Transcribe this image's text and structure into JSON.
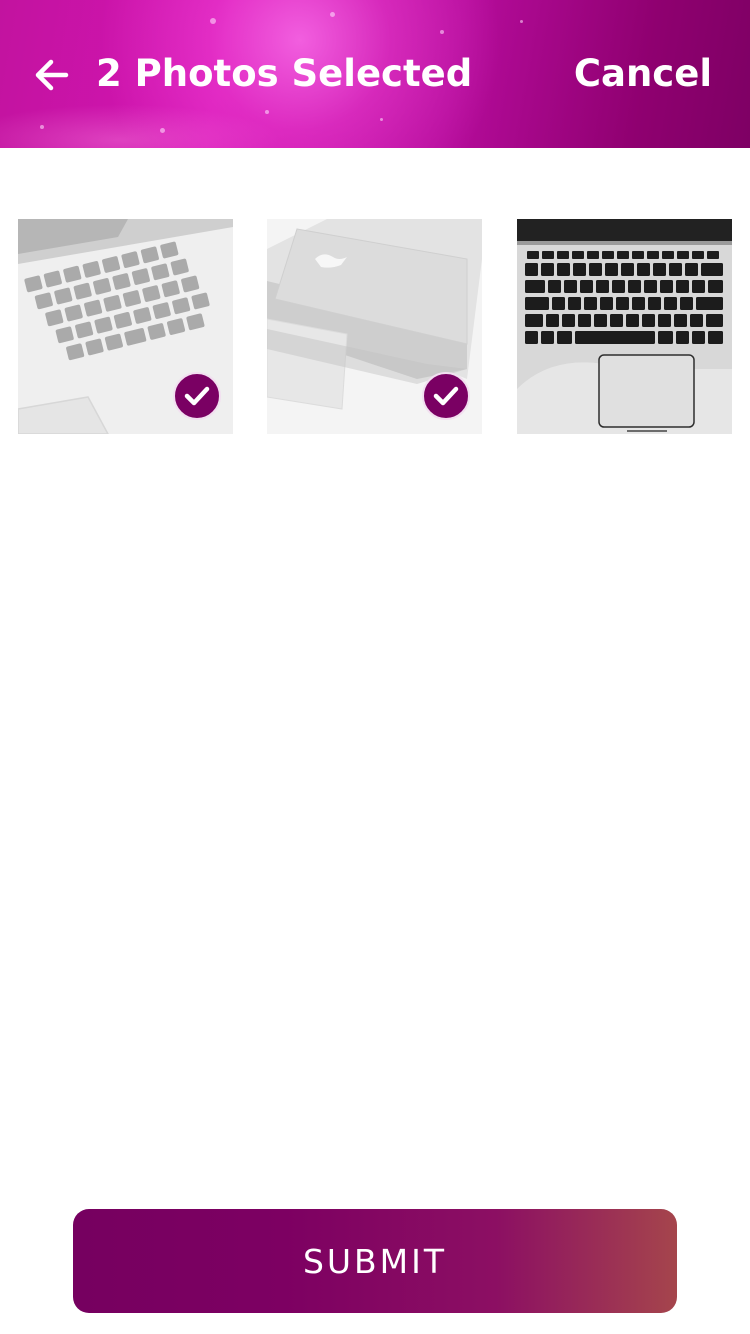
{
  "header": {
    "back_icon": "arrow-left-icon",
    "title": "2 Photos Selected",
    "cancel_label": "Cancel"
  },
  "photos": [
    {
      "subject": "laptop keyboard close-up",
      "selected": true
    },
    {
      "subject": "closed laptop lid",
      "selected": true
    },
    {
      "subject": "laptop keyboard and trackpad",
      "selected": false
    }
  ],
  "selection_icon": "checkmark-icon",
  "submit_label": "SUBMIT",
  "colors": {
    "accent": "#7a0063",
    "header_pink": "#c2139f",
    "button_start": "#760060",
    "button_end": "#a5454c",
    "text_on_accent": "#ffffff"
  }
}
